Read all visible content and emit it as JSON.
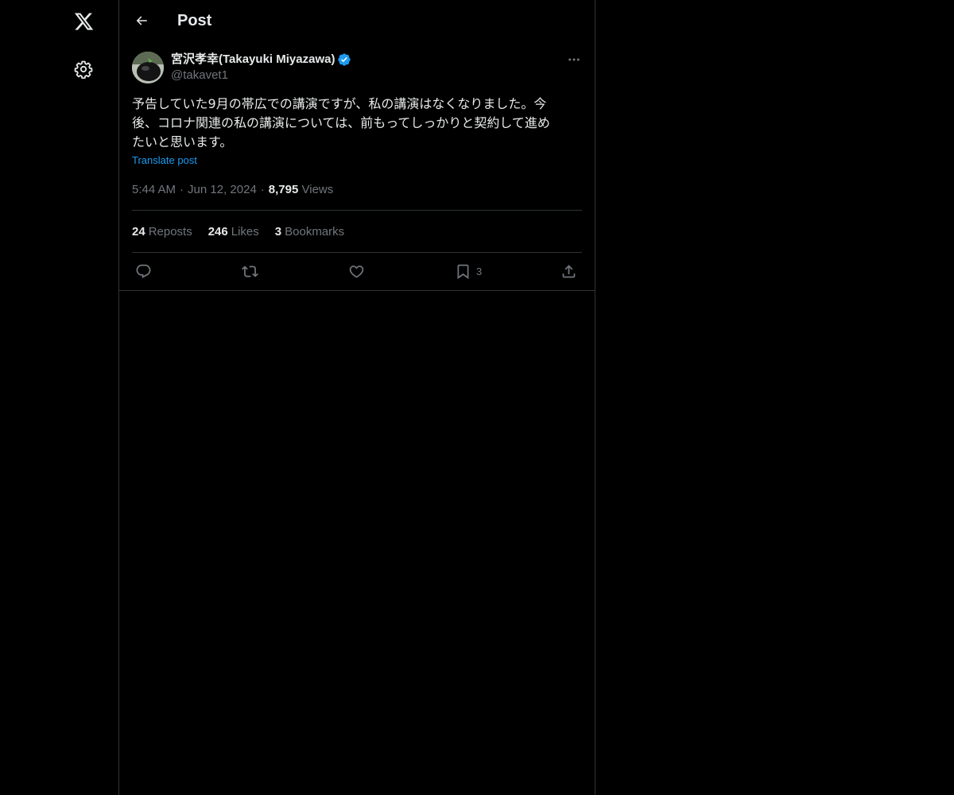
{
  "header": {
    "title": "Post"
  },
  "icons": {
    "logo": "x-logo-icon",
    "settings": "gear-icon",
    "back": "back-arrow-icon",
    "verified": "verified-badge-icon",
    "more": "more-dots-icon",
    "reply": "reply-icon",
    "repost": "repost-icon",
    "like": "heart-icon",
    "bookmark": "bookmark-icon",
    "share": "share-icon"
  },
  "colors": {
    "background": "#000000",
    "accent": "#1d9bf0",
    "text": "#e7e9ea",
    "muted": "#71767b",
    "border": "#2f3336"
  },
  "post": {
    "author": {
      "display_name": "宮沢孝幸(Takayuki Miyazawa)",
      "handle": "@takavet1"
    },
    "text_lines": [
      "予告していた9月の帯広での講演ですが、私の講演はなくなりました。今",
      "後、コロナ関連の私の講演については、前もってしっかりと契約して進め",
      "たいと思います。"
    ],
    "translate_label": "Translate post",
    "time": "5:44 AM",
    "date": "Jun 12, 2024",
    "views_count": "8,795",
    "views_label": "Views",
    "stats": {
      "reposts_count": "24",
      "reposts_label": "Reposts",
      "likes_count": "246",
      "likes_label": "Likes",
      "bookmarks_count": "3",
      "bookmarks_label": "Bookmarks"
    },
    "actions": {
      "bookmark_count": "3"
    }
  }
}
